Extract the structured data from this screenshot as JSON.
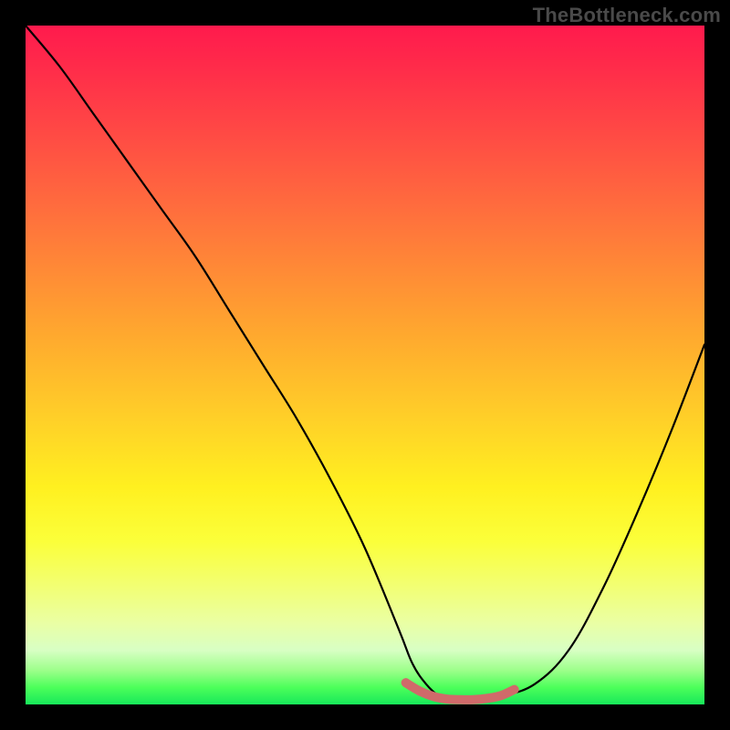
{
  "watermark": "TheBottleneck.com",
  "chart_data": {
    "type": "line",
    "title": "",
    "xlabel": "",
    "ylabel": "",
    "xlim": [
      0,
      100
    ],
    "ylim": [
      0,
      100
    ],
    "grid": false,
    "series": [
      {
        "name": "bottleneck-curve",
        "x": [
          0,
          5,
          10,
          15,
          20,
          25,
          30,
          35,
          40,
          45,
          50,
          55,
          57,
          59,
          61,
          63,
          65,
          67,
          70,
          75,
          80,
          85,
          90,
          95,
          100
        ],
        "values": [
          100,
          94,
          87,
          80,
          73,
          66,
          58,
          50,
          42,
          33,
          23,
          11,
          6,
          3,
          1.2,
          0.7,
          0.7,
          0.8,
          1.2,
          3,
          8,
          17,
          28,
          40,
          53
        ]
      },
      {
        "name": "bottom-highlight",
        "x": [
          56,
          58,
          60,
          62,
          64,
          66,
          68,
          70,
          72
        ],
        "values": [
          3.2,
          2.0,
          1.2,
          0.8,
          0.7,
          0.7,
          0.9,
          1.3,
          2.2
        ]
      }
    ],
    "colors": {
      "curve": "#000000",
      "highlight": "#d06a6a"
    }
  }
}
